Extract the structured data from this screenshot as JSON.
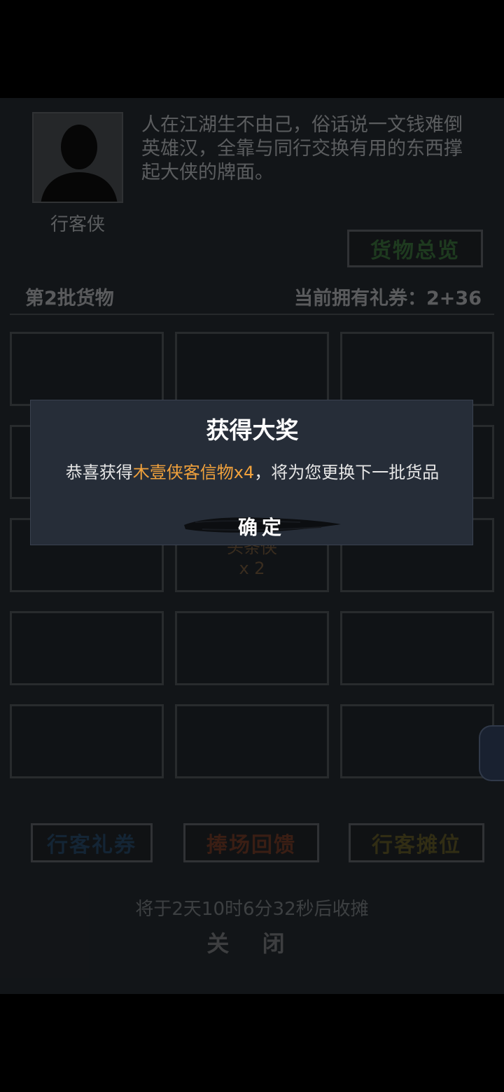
{
  "npc": {
    "name": "行客侠",
    "intro": "人在江湖生不由己，俗话说一文钱难倒英雄汉，全靠与同行交换有用的东西撑起大侠的牌面。"
  },
  "buttons": {
    "goods_overview": "货物总览",
    "coupons": "行客礼券",
    "support": "捧场回馈",
    "stall": "行客摊位",
    "close": "关 闭"
  },
  "batch": {
    "label": "第2批货物",
    "coupon_prefix": "当前拥有礼券：",
    "coupon_value": "2+36"
  },
  "slots": {
    "visible_item_name": "头条侠",
    "visible_item_qty": "x 2"
  },
  "countdown": "将于2天10时6分32秒后收摊",
  "dialog": {
    "title": "获得大奖",
    "msg_prefix": "恭喜获得",
    "msg_item": "木壹侠客信物x4",
    "msg_suffix": "，将为您更换下一批货品",
    "confirm": "确定"
  },
  "colors": {
    "highlight": "#f2a23c",
    "goods_overview": "#2f5a31",
    "coupons": "#1f3a52",
    "support": "#5a2e20",
    "stall": "#4c4620"
  }
}
